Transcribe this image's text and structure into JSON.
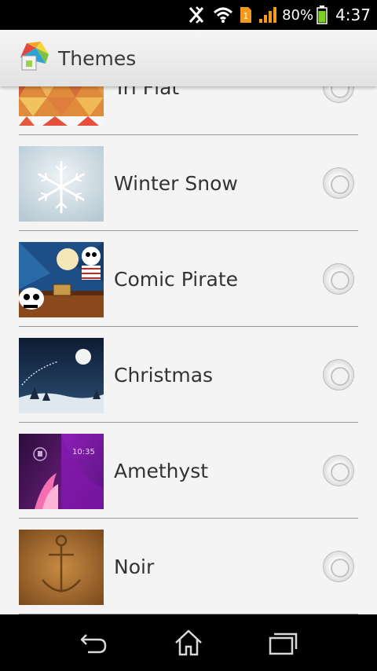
{
  "status_bar": {
    "battery_percent": "80%",
    "time": "4:37",
    "icons": [
      "nfc-off-icon",
      "wifi-icon",
      "sim-notice-icon",
      "signal-icon",
      "battery-icon"
    ]
  },
  "action_bar": {
    "title": "Themes",
    "app_icon": "themes-app-icon"
  },
  "themes": [
    {
      "name": "Tri Flat",
      "selected": false
    },
    {
      "name": "Winter Snow",
      "selected": false
    },
    {
      "name": "Comic Pirate",
      "selected": false
    },
    {
      "name": "Christmas",
      "selected": false
    },
    {
      "name": "Amethyst",
      "selected": false,
      "thumbnail_time": "10:35"
    },
    {
      "name": "Noir",
      "selected": false
    }
  ],
  "nav_bar": {
    "buttons": [
      "back-icon",
      "home-icon",
      "recent-apps-icon"
    ]
  }
}
